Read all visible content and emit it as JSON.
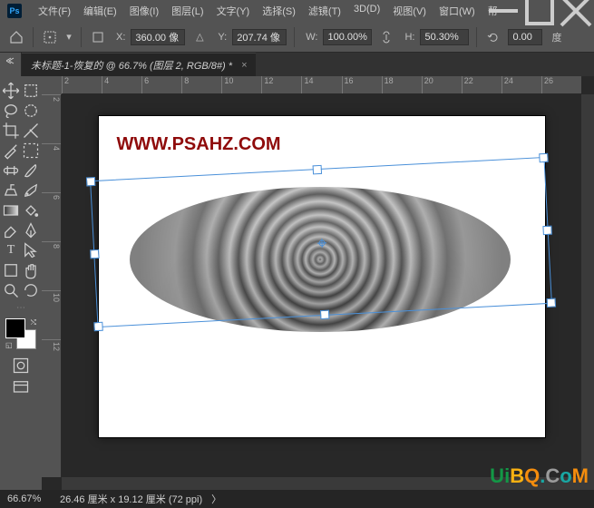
{
  "app": {
    "logo": "Ps"
  },
  "menus": [
    "文件(F)",
    "编辑(E)",
    "图像(I)",
    "图层(L)",
    "文字(Y)",
    "选择(S)",
    "滤镜(T)",
    "3D(D)",
    "视图(V)",
    "窗口(W)",
    "帮"
  ],
  "optbar": {
    "x_label": "X:",
    "x_value": "360.00 像",
    "y_label": "Y:",
    "y_value": "207.74 像",
    "w_label": "W:",
    "w_value": "100.00%",
    "h_label": "H:",
    "h_value": "50.30%",
    "rot_value": "0.00",
    "deg_label": "度"
  },
  "tab": {
    "title": "未标题-1-恢复的 @ 66.7% (图层 2, RGB/8#) *"
  },
  "ruler_h": [
    "2",
    "4",
    "6",
    "8",
    "10",
    "12",
    "14",
    "16",
    "18",
    "20",
    "22",
    "24",
    "26"
  ],
  "ruler_v": [
    "2",
    "4",
    "6",
    "8",
    "10",
    "12"
  ],
  "canvas": {
    "watermark": "WWW.PSAHZ.COM"
  },
  "colors": {
    "fg": "#000000",
    "bg": "#ffffff"
  },
  "status": {
    "zoom": "66.67%",
    "info": "26.46 厘米 x 19.12 厘米 (72 ppi)",
    "arrow": "〉"
  },
  "corner_logo": "UiBQ.CoM"
}
